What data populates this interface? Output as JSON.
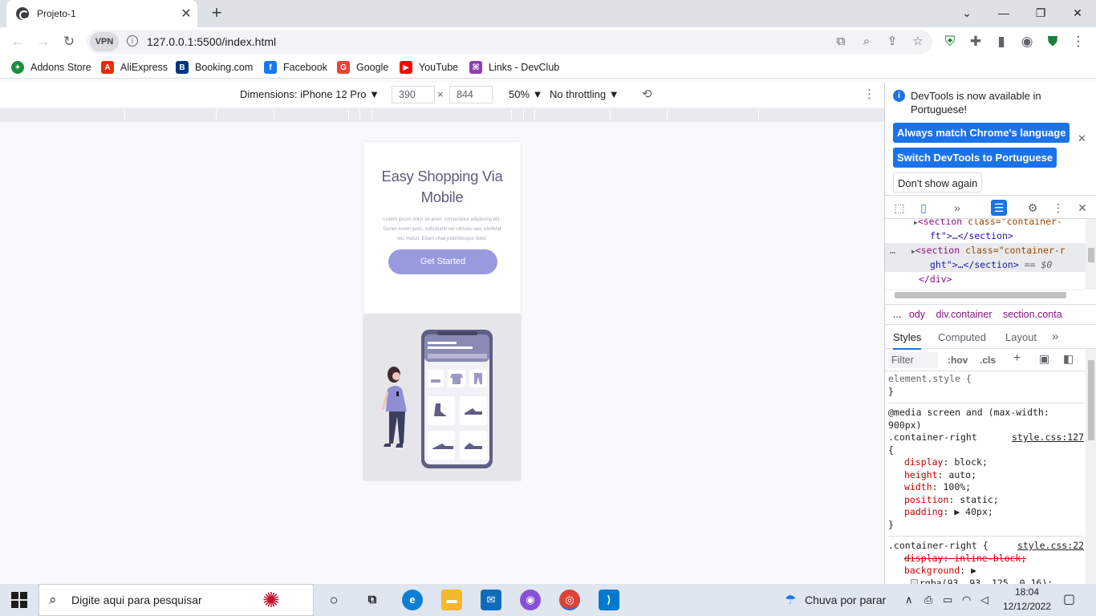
{
  "tab": {
    "title": "Projeto-1",
    "close": "✕",
    "newtab": "+"
  },
  "window": {
    "chevron": "⌄",
    "minimize": "—",
    "restore": "❐",
    "close": "✕"
  },
  "toolbar": {
    "back": "←",
    "forward": "→",
    "reload": "↻",
    "vpn": "VPN",
    "info": "i",
    "url": "127.0.0.1:5500/index.html"
  },
  "bookmarks": [
    {
      "label": "Addons Store",
      "color": "#1e8e3e",
      "glyph": "✦"
    },
    {
      "label": "AliExpress",
      "color": "#e62e04",
      "glyph": "A"
    },
    {
      "label": "Booking.com",
      "color": "#003580",
      "glyph": "B"
    },
    {
      "label": "Facebook",
      "color": "#1877f2",
      "glyph": "f"
    },
    {
      "label": "Google",
      "color": "#ea4335",
      "glyph": "G"
    },
    {
      "label": "YouTube",
      "color": "#ff0000",
      "glyph": "▶"
    },
    {
      "label": "Links - DevClub",
      "color": "#8e3fb5",
      "glyph": "⌘"
    }
  ],
  "devbar": {
    "dimensions": "Dimensions: iPhone 12 Pro",
    "width": "390",
    "times": "×",
    "height": "844",
    "zoom": "50%",
    "throttling": "No throttling"
  },
  "page": {
    "title": "Easy Shopping Via Mobile",
    "text": "Lorem ipsum dolor sit amet, consectetur adipiscing elit. Donec lorem justo, sollicitudin vel ultricies sed, eleifend nec metus. Etiam vitae pellentesque dolor.",
    "button": "Get Started"
  },
  "devtools": {
    "info": "DevTools is now available in Portuguese!",
    "btn_match": "Always match Chrome's language",
    "btn_switch": "Switch DevTools to Portuguese",
    "btn_dont": "Don't show again",
    "crumbs": [
      "...",
      "ody",
      "div.container",
      "section.conta"
    ],
    "tabs": [
      "Styles",
      "Computed",
      "Layout",
      "»"
    ],
    "filter": "Filter",
    "hov": ":hov",
    "cls": ".cls",
    "el_line1_attr": "class=\"container-",
    "el_line1b": "ft\">…</section>",
    "el_line2_attr": "class=\"container-r",
    "el_line2b": "ght\">…</section>",
    "el_line2c": "== $0",
    "el_line3": "</div>",
    "style_element": "element.style {",
    "style_close": "}",
    "media": "@media screen and (max-width: 900px)",
    "selector": ".container-right",
    "link1": "style.css:127",
    "props": [
      {
        "name": "display",
        "value": "block;"
      },
      {
        "name": "height",
        "value": "auto;"
      },
      {
        "name": "width",
        "value": "100%;"
      },
      {
        "name": "position",
        "value": "static;"
      },
      {
        "name": "padding",
        "value": "▶ 40px;"
      }
    ],
    "selector2": ".container-right {",
    "link2": "style.css:22",
    "strike_prop": "display: inline-block;",
    "bg_prop": "background",
    "bg_value": "rgba(93, 93, 125, 0.16);"
  },
  "taskbar": {
    "search": "Digite aqui para pesquisar",
    "weather": "Chuva por parar",
    "time": "18:04",
    "date": "12/12/2022"
  }
}
